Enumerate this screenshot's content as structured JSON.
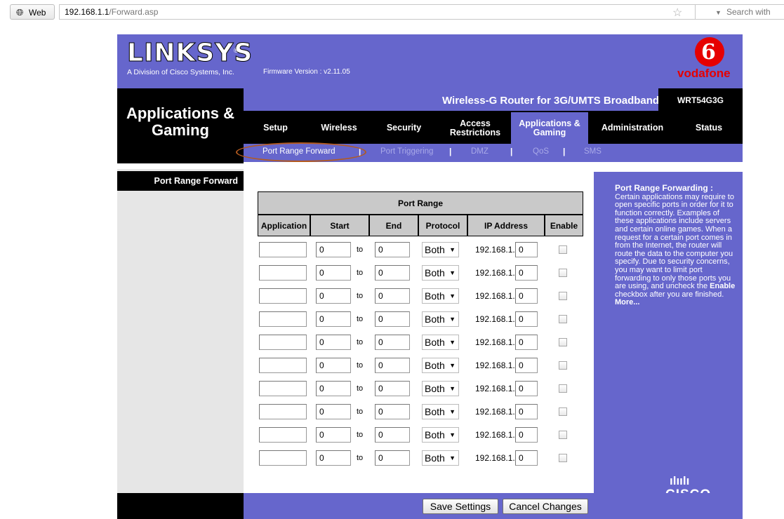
{
  "browser": {
    "web_button": "Web",
    "url_host": "192.168.1.1",
    "url_path": "/Forward.asp",
    "search_placeholder": "Search with"
  },
  "header": {
    "brand": "LINKSYS",
    "registered": "®",
    "brand_sub": "A Division of Cisco Systems, Inc.",
    "firmware": "Firmware Version : v2.11.05",
    "vodafone_text": "vodafone",
    "product_name": "Wireless-G Router for 3G/UMTS Broadband",
    "model": "WRT54G3G"
  },
  "section_title": "Applications & Gaming",
  "nav": {
    "items": [
      {
        "label": "Setup"
      },
      {
        "label": "Wireless"
      },
      {
        "label": "Security"
      },
      {
        "label": "Access Restrictions"
      },
      {
        "label": "Applications & Gaming"
      },
      {
        "label": "Administration"
      },
      {
        "label": "Status"
      }
    ],
    "active": "Applications & Gaming"
  },
  "subnav": {
    "items": [
      {
        "label": "Port Range Forward"
      },
      {
        "label": "Port Triggering"
      },
      {
        "label": "DMZ"
      },
      {
        "label": "QoS"
      },
      {
        "label": "SMS"
      }
    ],
    "separator": "|"
  },
  "left_label": "Port Range Forward",
  "table": {
    "group_header": "Port Range",
    "columns": [
      "Application",
      "Start",
      "End",
      "Protocol",
      "IP Address",
      "Enable"
    ],
    "to_label": "to",
    "ip_prefix": "192.168.1.",
    "rows": [
      {
        "application": "",
        "start": "0",
        "end": "0",
        "protocol": "Both",
        "ip_last": "0",
        "enabled": false
      },
      {
        "application": "",
        "start": "0",
        "end": "0",
        "protocol": "Both",
        "ip_last": "0",
        "enabled": false
      },
      {
        "application": "",
        "start": "0",
        "end": "0",
        "protocol": "Both",
        "ip_last": "0",
        "enabled": false
      },
      {
        "application": "",
        "start": "0",
        "end": "0",
        "protocol": "Both",
        "ip_last": "0",
        "enabled": false
      },
      {
        "application": "",
        "start": "0",
        "end": "0",
        "protocol": "Both",
        "ip_last": "0",
        "enabled": false
      },
      {
        "application": "",
        "start": "0",
        "end": "0",
        "protocol": "Both",
        "ip_last": "0",
        "enabled": false
      },
      {
        "application": "",
        "start": "0",
        "end": "0",
        "protocol": "Both",
        "ip_last": "0",
        "enabled": false
      },
      {
        "application": "",
        "start": "0",
        "end": "0",
        "protocol": "Both",
        "ip_last": "0",
        "enabled": false
      },
      {
        "application": "",
        "start": "0",
        "end": "0",
        "protocol": "Both",
        "ip_last": "0",
        "enabled": false
      },
      {
        "application": "",
        "start": "0",
        "end": "0",
        "protocol": "Both",
        "ip_last": "0",
        "enabled": false
      }
    ]
  },
  "help": {
    "heading": "Port Range Forwarding :",
    "body_before": "Certain applications may require to open specific ports in order for it to function correctly. Examples of these applications include servers and certain online games. When a request for a certain port comes in from the Internet, the router will route the data to the computer you specify. Due to security concerns, you may want to limit port forwarding to only those ports you are using, and uncheck the",
    "body_bold": "Enable",
    "body_after": "checkbox after you are finished.",
    "more": "More..."
  },
  "cisco": {
    "bars": "ılıılı",
    "word": "CISCO"
  },
  "buttons": {
    "save": "Save Settings",
    "cancel": "Cancel Changes"
  },
  "colors": {
    "purple": "#6666cc",
    "black": "#000000",
    "vodafone_red": "#e60000",
    "highlight": "#b35a1f"
  },
  "icons": [
    "globe-icon",
    "star-icon",
    "dropdown-icon",
    "vodafone-logo-icon",
    "cisco-logo-icon"
  ]
}
